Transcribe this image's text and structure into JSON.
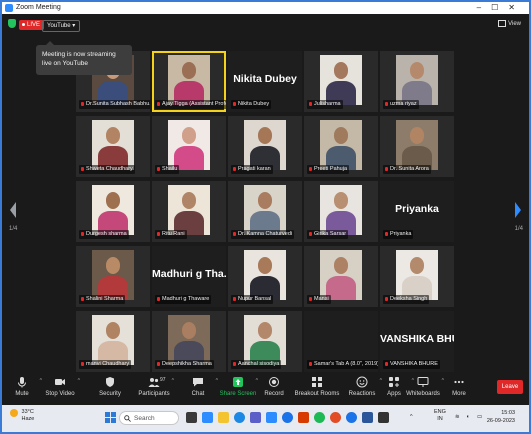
{
  "window": {
    "title": "Zoom Meeting"
  },
  "topbar": {
    "live_label": "LIVE",
    "stream_target": "YouTube",
    "view_label": "View"
  },
  "tooltip": {
    "text": "Meeting is now streaming live on YouTube"
  },
  "pager": {
    "left": "1/4",
    "right": "1/4"
  },
  "participants": [
    {
      "name": "Dr.Sunita Subhash Babhu...",
      "big": "",
      "video": true,
      "colors": [
        "#5b4a3f",
        "#c89a7a",
        "#3b4d7a"
      ]
    },
    {
      "name": "Ajay Tigga (Assistant Professi...",
      "big": "",
      "video": true,
      "active": true,
      "colors": [
        "#c7b9a4",
        "#9a6f54",
        "#b73a6a"
      ]
    },
    {
      "name": "Nikita Dubey",
      "big": "Nikita Dubey",
      "video": false
    },
    {
      "name": "Julisharma",
      "big": "",
      "video": true,
      "colors": [
        "#e6e2dc",
        "#a3785c",
        "#3f3a55"
      ]
    },
    {
      "name": "uzma riyaz",
      "big": "",
      "video": true,
      "colors": [
        "#b9b3ac",
        "#b58a6c",
        "#7f7b8a"
      ]
    },
    {
      "name": "Shweta Chaudhary",
      "big": "",
      "video": true,
      "colors": [
        "#e3dfd7",
        "#b28463",
        "#8a3c3c"
      ]
    },
    {
      "name": "Shailu",
      "big": "",
      "video": true,
      "colors": [
        "#f1e9e6",
        "#d0a08a",
        "#d44b8a"
      ]
    },
    {
      "name": "Pragati karan",
      "big": "",
      "video": true,
      "colors": [
        "#ddd7cf",
        "#a67757",
        "#2f2f36"
      ]
    },
    {
      "name": "Preeti Pahuja",
      "big": "",
      "video": true,
      "colors": [
        "#c4b8a6",
        "#a07a5c",
        "#4c5b6e"
      ]
    },
    {
      "name": "Dr. Sunita Arora",
      "big": "",
      "video": true,
      "colors": [
        "#8d7c6a",
        "#b18564",
        "#6b5b4b"
      ]
    },
    {
      "name": "Durgesh sharma",
      "big": "",
      "video": true,
      "colors": [
        "#efe8df",
        "#9f7050",
        "#c4487a"
      ]
    },
    {
      "name": "Ritu Rani",
      "big": "",
      "video": true,
      "colors": [
        "#ece5d8",
        "#b08567",
        "#6b3f3f"
      ]
    },
    {
      "name": "Dr. Kamna Chaturvedi",
      "big": "",
      "video": true,
      "colors": [
        "#d9d4ca",
        "#a97c5f",
        "#6b7a8c"
      ]
    },
    {
      "name": "Girika Sarsar",
      "big": "",
      "video": true,
      "colors": [
        "#e8e4df",
        "#b88f70",
        "#7a5a9a"
      ]
    },
    {
      "name": "Priyanka",
      "big": "Priyanka",
      "video": false
    },
    {
      "name": "Shalini Sharma",
      "big": "",
      "video": true,
      "colors": [
        "#6b5a4a",
        "#b98a66",
        "#b23a3a"
      ]
    },
    {
      "name": "Madhuri g Thaware",
      "big": "Madhuri g Tha...",
      "video": false
    },
    {
      "name": "Nupur Bansal",
      "big": "",
      "video": true,
      "colors": [
        "#e9e4dd",
        "#a87a5a",
        "#2b2b33"
      ]
    },
    {
      "name": "Mansi",
      "big": "",
      "video": true,
      "colors": [
        "#d6d0c5",
        "#ad8163",
        "#c56a8a"
      ]
    },
    {
      "name": "Deeksha Singh",
      "big": "",
      "video": true,
      "colors": [
        "#ece8e3",
        "#b38a6c",
        "#d9d0c8"
      ]
    },
    {
      "name": "manvi Chaudhary",
      "big": "",
      "video": true,
      "colors": [
        "#e5e0d8",
        "#b08463",
        "#d5b9a5"
      ]
    },
    {
      "name": "Deepshikha Sharma",
      "big": "",
      "video": true,
      "colors": [
        "#7d6a58",
        "#a97e61",
        "#4a4a5a"
      ]
    },
    {
      "name": "Aanchal sisodiya",
      "big": "",
      "video": true,
      "colors": [
        "#e2ddd5",
        "#b3876a",
        "#3d8a5a"
      ]
    },
    {
      "name": "Samar's Tab A (8.0\", 2019)",
      "big": "",
      "video": false
    },
    {
      "name": "VANSHIKA BHURE",
      "big": "VANSHIKA BHU...",
      "video": false
    }
  ],
  "toolbar": {
    "mute": "Mute",
    "stop_video": "Stop Video",
    "security": "Security",
    "participants": "Participants",
    "participants_count": "97",
    "chat": "Chat",
    "share_screen": "Share Screen",
    "record": "Record",
    "breakout_rooms": "Breakout Rooms",
    "reactions": "Reactions",
    "apps": "Apps",
    "whiteboards": "Whiteboards",
    "more": "More",
    "leave": "Leave"
  },
  "taskbar": {
    "temperature": "33°C",
    "weather": "Haze",
    "search_placeholder": "Search",
    "lang_top": "ENG",
    "lang_bottom": "IN",
    "time": "15:03",
    "date": "26-09-2023"
  },
  "colors": {
    "accent": "#2d8cff",
    "live": "#e02828",
    "active_speaker": "#f4d21a",
    "share": "#23c35e"
  }
}
